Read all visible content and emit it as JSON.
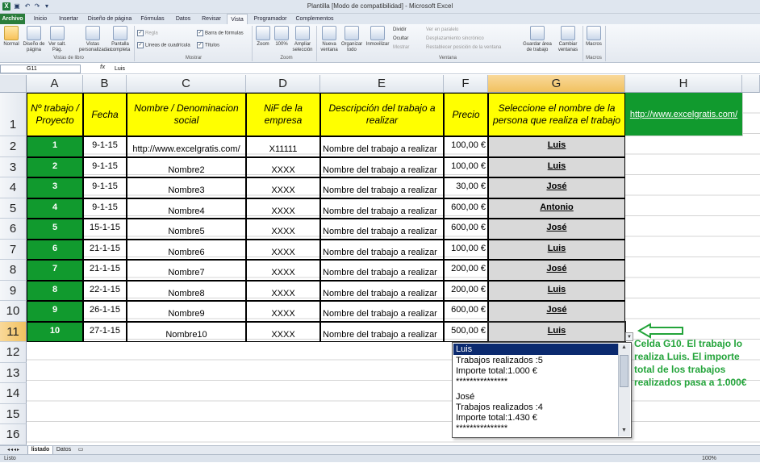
{
  "window": {
    "title": "Plantilla  [Modo de compatibilidad] - Microsoft Excel"
  },
  "tabs": [
    "Archivo",
    "Inicio",
    "Insertar",
    "Diseño de página",
    "Fórmulas",
    "Datos",
    "Revisar",
    "Vista",
    "Programador",
    "Complementos"
  ],
  "ribbon": {
    "normal": "Normal",
    "diseno_pagina": "Diseño de página",
    "ver_salt": "Ver salt. Pág.",
    "vistas_pers": "Vistas personalizadas",
    "pantalla_completa": "Pantalla completa",
    "regla": "Regla",
    "barra_formulas": "Barra de fórmulas",
    "lineas_cuadricula": "Líneas de cuadrícula",
    "titulos": "Títulos",
    "zoom": "Zoom",
    "zoom100": "100%",
    "ampliar": "Ampliar selección",
    "nueva_ventana": "Nueva ventana",
    "organizar": "Organizar todo",
    "inmovilizar": "Inmovilizar",
    "dividir": "Dividir",
    "ocultar": "Ocultar",
    "mostrar": "Mostrar",
    "ver_paralelo": "Ver en paralelo",
    "desplazamiento": "Desplazamiento sincrónico",
    "restablecer": "Restablecer posición de la ventana",
    "guardar_area": "Guardar área de trabajo",
    "cambiar_ventanas": "Cambiar ventanas",
    "macros": "Macros",
    "groups": [
      "Vistas de libro",
      "Mostrar",
      "Zoom",
      "Ventana",
      "Macros"
    ]
  },
  "formula_bar": {
    "name_box": "G11",
    "fx": "fx",
    "value": "Luis"
  },
  "columns": [
    "A",
    "B",
    "C",
    "D",
    "E",
    "F",
    "G",
    "H"
  ],
  "rows": [
    "1",
    "2",
    "3",
    "4",
    "5",
    "6",
    "7",
    "8",
    "9",
    "10",
    "11",
    "12",
    "13",
    "14",
    "15",
    "16"
  ],
  "headers": {
    "a": "Nº trabajo / Proyecto",
    "b": "Fecha",
    "c": "Nombre / Denominacion social",
    "d": "NiF de la empresa",
    "e": "Descripción del trabajo a realizar",
    "f": "Precio",
    "g": "Seleccione el nombre de la persona que realiza el trabajo",
    "h": "http://www.excelgratis.com/"
  },
  "table": [
    {
      "num": "1",
      "fecha": "9-1-15",
      "nombre": "http://www.excelgratis.com/",
      "nif": "X11111",
      "desc": "Nombre del trabajo a realizar",
      "precio": "100,00 €",
      "persona": "Luis"
    },
    {
      "num": "2",
      "fecha": "9-1-15",
      "nombre": "Nombre2",
      "nif": "XXXX",
      "desc": "Nombre del trabajo a realizar",
      "precio": "100,00 €",
      "persona": "Luis"
    },
    {
      "num": "3",
      "fecha": "9-1-15",
      "nombre": "Nombre3",
      "nif": "XXXX",
      "desc": "Nombre del trabajo a realizar",
      "precio": "30,00 €",
      "persona": "José"
    },
    {
      "num": "4",
      "fecha": "9-1-15",
      "nombre": "Nombre4",
      "nif": "XXXX",
      "desc": "Nombre del trabajo a realizar",
      "precio": "600,00 €",
      "persona": "Antonio"
    },
    {
      "num": "5",
      "fecha": "15-1-15",
      "nombre": "Nombre5",
      "nif": "XXXX",
      "desc": "Nombre del trabajo a realizar",
      "precio": "600,00 €",
      "persona": "José"
    },
    {
      "num": "6",
      "fecha": "21-1-15",
      "nombre": "Nombre6",
      "nif": "XXXX",
      "desc": "Nombre del trabajo a realizar",
      "precio": "100,00 €",
      "persona": "Luis"
    },
    {
      "num": "7",
      "fecha": "21-1-15",
      "nombre": "Nombre7",
      "nif": "XXXX",
      "desc": "Nombre del trabajo a realizar",
      "precio": "200,00 €",
      "persona": "José"
    },
    {
      "num": "8",
      "fecha": "22-1-15",
      "nombre": "Nombre8",
      "nif": "XXXX",
      "desc": "Nombre del trabajo a realizar",
      "precio": "200,00 €",
      "persona": "Luis"
    },
    {
      "num": "9",
      "fecha": "26-1-15",
      "nombre": "Nombre9",
      "nif": "XXXX",
      "desc": "Nombre del trabajo a realizar",
      "precio": "600,00 €",
      "persona": "José"
    },
    {
      "num": "10",
      "fecha": "27-1-15",
      "nombre": "Nombre10",
      "nif": "XXXX",
      "desc": "Nombre del trabajo a realizar",
      "precio": "500,00 €",
      "persona": "Luis"
    }
  ],
  "dropdown": {
    "selected": "Luis",
    "lines": [
      "Trabajos realizados :5",
      "Importe total:1.000 €",
      "***************",
      "",
      "José",
      "Trabajos realizados :4",
      "Importe total:1.430 €",
      "***************"
    ]
  },
  "annotation": "Celda G10. El trabajo lo realiza Luis. El importe total de los trabajos realizados pasa a 1.000€",
  "sheets": [
    "listado",
    "Datos"
  ],
  "status": {
    "left": "Listo",
    "zoom": "100%"
  },
  "colors": {
    "header_yellow": "#ffff00",
    "green": "#119a2e",
    "annotation_green": "#23a43a",
    "selected_blue": "#0b2a6f"
  }
}
